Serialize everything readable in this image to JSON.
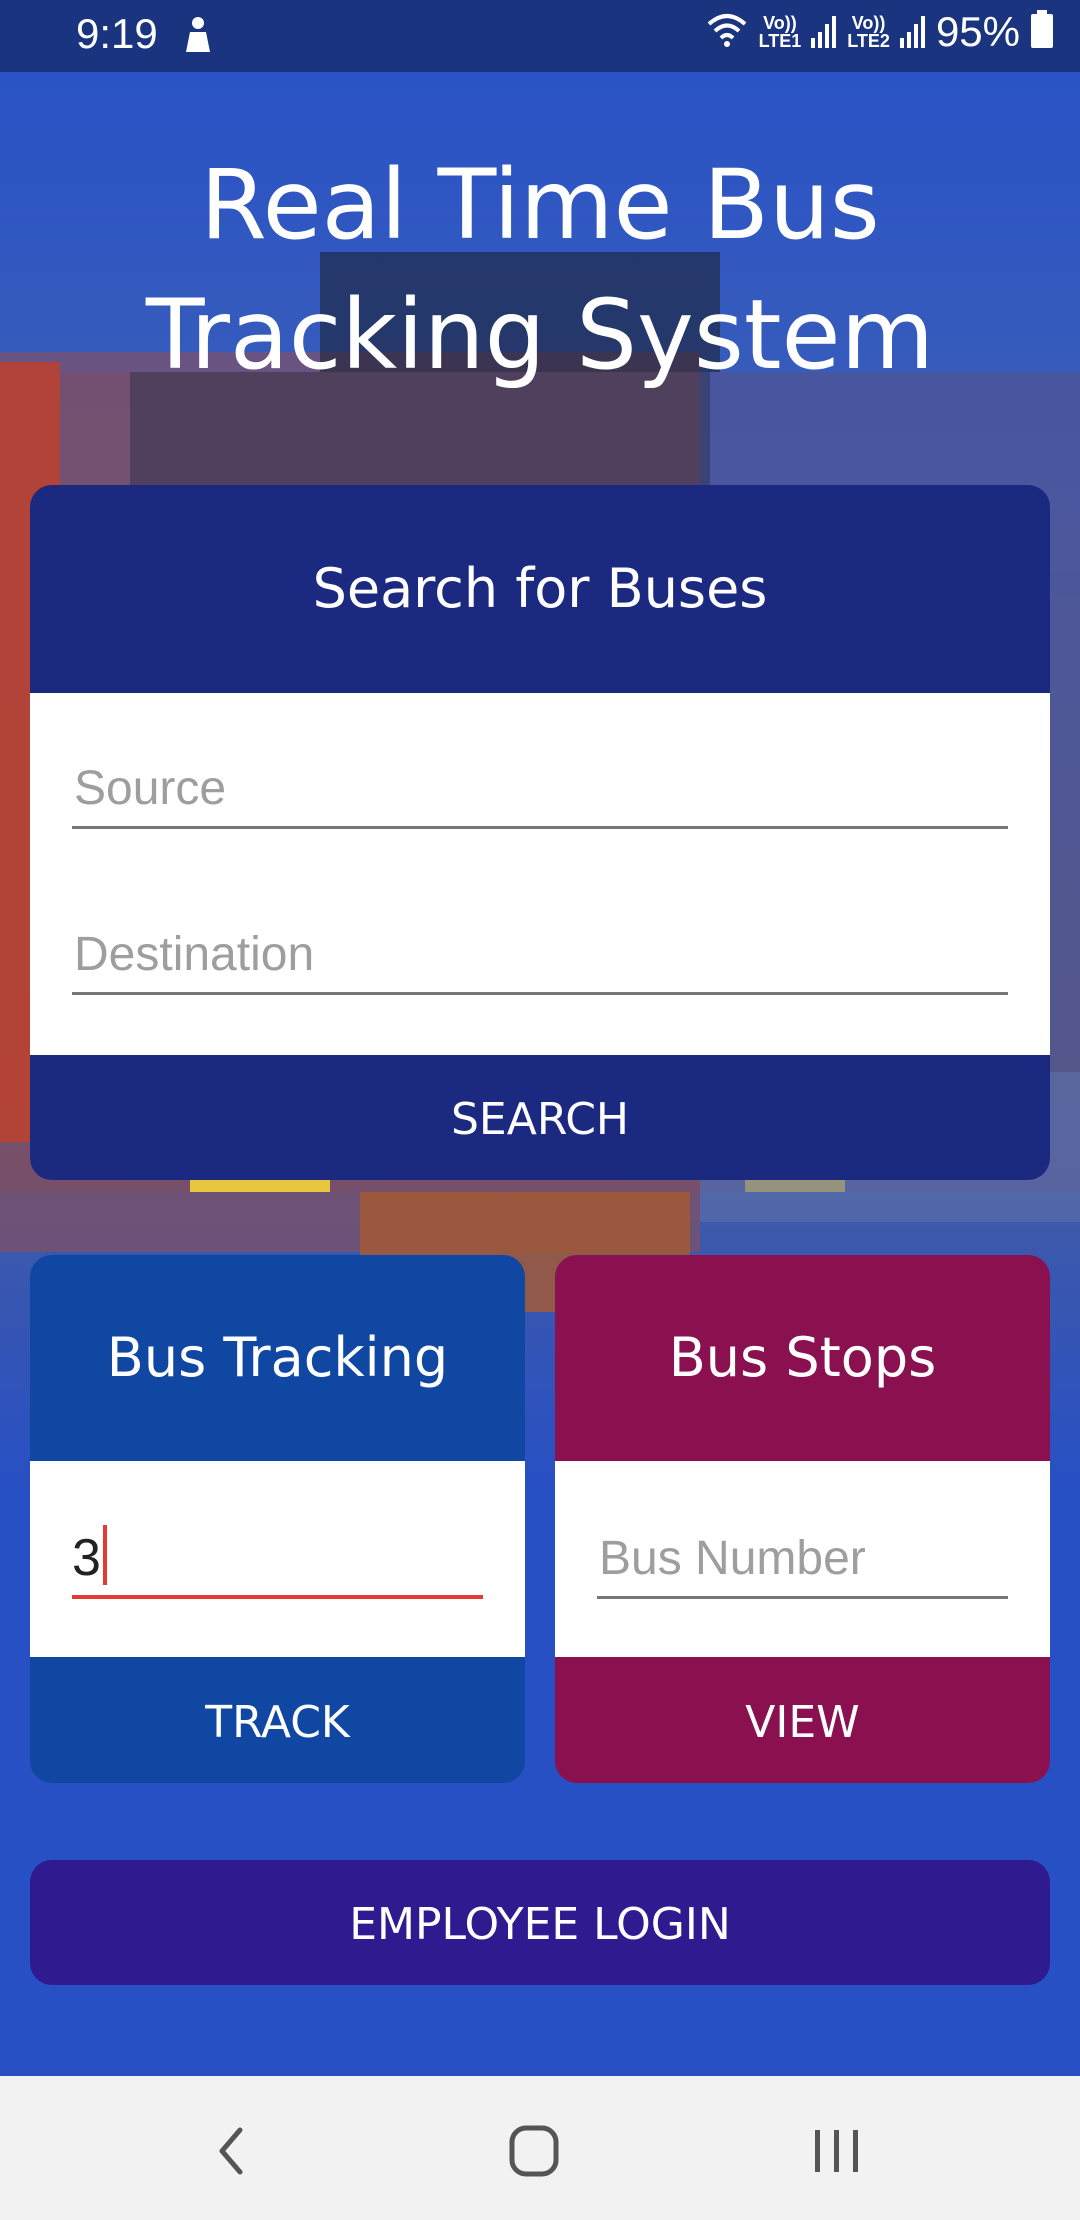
{
  "status_bar": {
    "time": "9:19",
    "sim1_top": "Vo))",
    "sim1_bottom": "LTE1",
    "sim2_top": "Vo))",
    "sim2_bottom": "LTE2",
    "battery": "95%"
  },
  "app": {
    "title_line1": "Real Time Bus",
    "title_line2": "Tracking System"
  },
  "search_card": {
    "header": "Search for Buses",
    "source_placeholder": "Source",
    "destination_placeholder": "Destination",
    "button": "SEARCH"
  },
  "tracking_card": {
    "header": "Bus Tracking",
    "input_value": "3",
    "button": "TRACK"
  },
  "stops_card": {
    "header": "Bus Stops",
    "input_placeholder": "Bus Number",
    "button": "VIEW"
  },
  "employee_login": "EMPLOYEE LOGIN",
  "colors": {
    "primary": "#1b2a80",
    "tracking": "#0f47a3",
    "stops": "#8a1050",
    "login": "#2f1a90",
    "cursor": "#e53935"
  },
  "nav_bar": {
    "icons": [
      "back-icon",
      "home-icon",
      "recent-apps-icon"
    ]
  }
}
